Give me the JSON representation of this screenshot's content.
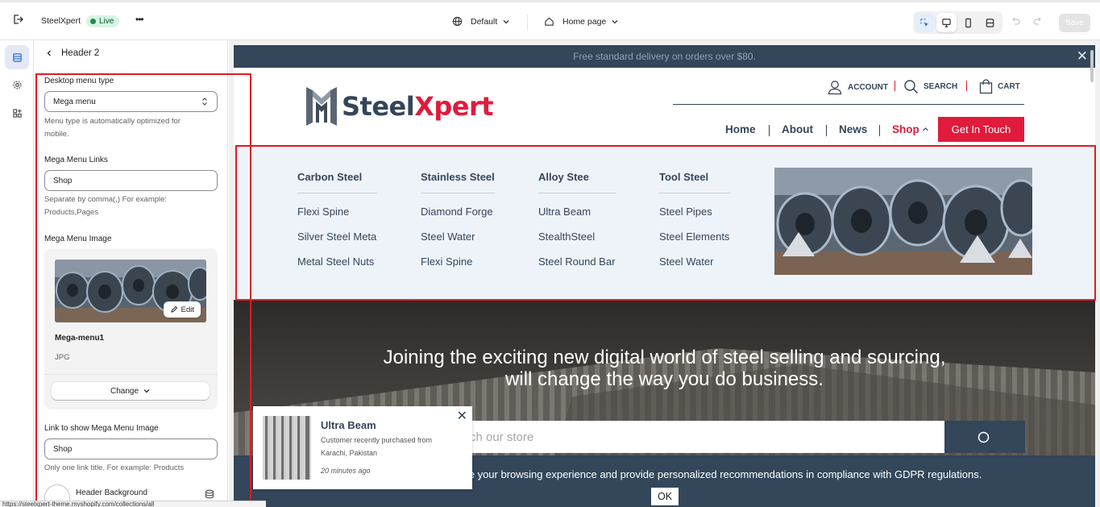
{
  "topbar": {
    "store_name": "SteelXpert",
    "status": "Live",
    "more": "•••",
    "theme_select": "Default",
    "page_select": "Home page",
    "save_label": "Save"
  },
  "panel": {
    "title": "Header 2",
    "menu_type_label": "Desktop menu type",
    "menu_type_value": "Mega menu",
    "menu_type_help": "Menu type is automatically optimized for mobile.",
    "links_label": "Mega Menu Links",
    "links_value": "Shop",
    "links_help": "Separate by comma(,) For example: Products,Pages",
    "image_label": "Mega Menu Image",
    "edit_label": "Edit",
    "image_name": "Mega-menu1",
    "image_type": "JPG",
    "change_label": "Change",
    "show_image_label": "Link to show Mega Menu Image",
    "show_image_value": "Shop",
    "show_image_help": "Only one link title. For example: Products",
    "bg_label": "Header Background"
  },
  "store": {
    "announcement": "Free standard delivery on orders over $80.",
    "logo_steel": "Steel",
    "logo_xpert": "Xpert",
    "account": "ACCOUNT",
    "search": "SEARCH",
    "cart": "CART",
    "nav": [
      "Home",
      "About",
      "News",
      "Shop"
    ],
    "cta": "Get In Touch",
    "mega_columns": [
      {
        "title": "Carbon Steel",
        "links": [
          "Flexi Spine",
          "Silver Steel Meta",
          "Metal Steel Nuts"
        ]
      },
      {
        "title": "Stainless Steel",
        "links": [
          "Diamond Forge",
          "Steel Water",
          "Flexi Spine"
        ]
      },
      {
        "title": "Alloy Stee",
        "links": [
          "Ultra Beam",
          "StealthSteel",
          "Steel Round Bar"
        ]
      },
      {
        "title": "Tool Steel",
        "links": [
          "Steel Pipes",
          "Steel Elements",
          "Steel Water"
        ]
      }
    ],
    "hero_line1": "Joining the exciting new digital world of steel selling and sourcing,",
    "hero_line2": "will change the way you do business.",
    "search_placeholder": "rch our store",
    "gdpr_text": "nce your browsing experience and provide personalized recommendations in compliance with GDPR regulations.",
    "ok": "OK",
    "popup": {
      "product": "Ultra Beam",
      "line1": "Customer recently purchased  from",
      "line2": "Karachi, Pakistan",
      "time": "20 minutes ago"
    }
  },
  "status_url": "https://steelxpert-theme.myshopify.com/collections/all",
  "colors": {
    "brand_navy": "#33465a",
    "brand_red": "#e01b3c",
    "annotation_red": "#e01b24",
    "mega_bg": "#eef3fa"
  }
}
